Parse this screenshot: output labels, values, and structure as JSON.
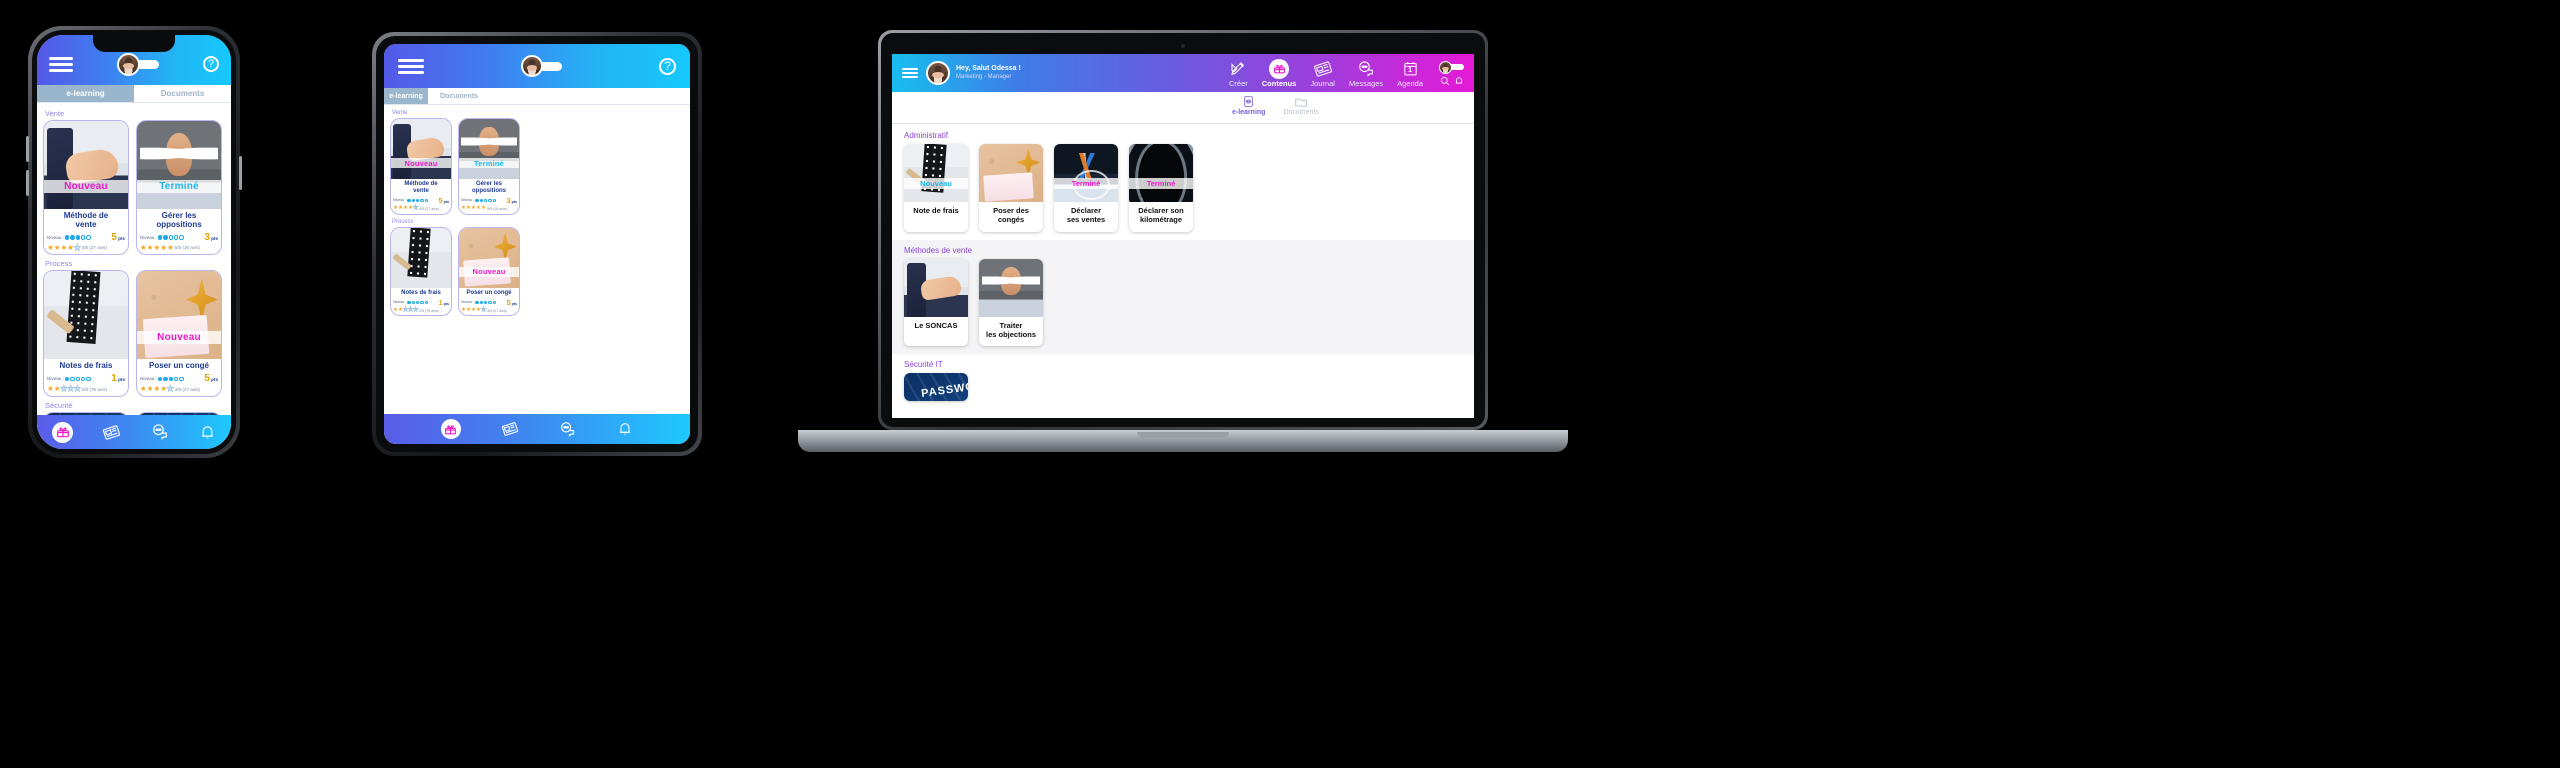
{
  "app": {
    "brand_gradient_start": "#5558e8",
    "brand_gradient_end": "#16c8ff",
    "accent_magenta": "#ee18c8",
    "accent_cyan": "#19b6ef",
    "title_blue": "#1f3a93"
  },
  "mobile": {
    "topbar": {
      "menu_icon": "hamburger-icon",
      "avatar_icon": "user-avatar",
      "help_label": "?"
    },
    "tabs": [
      {
        "label": "e-learning",
        "active": true
      },
      {
        "label": "Documents",
        "active": false
      }
    ],
    "sections": [
      {
        "title": "Vente",
        "cards": [
          {
            "badge": "Nouveau",
            "badge_type": "nouveau",
            "thumb": "t-handshake",
            "title": "Méthode de\nvente",
            "level_label": "Niveau :",
            "level_filled": 3,
            "level_total": 5,
            "points": "5",
            "points_unit": "pts",
            "stars_filled": 4,
            "stars_total": 5,
            "rating": "4/5 (27 avis)"
          },
          {
            "badge": "Terminé",
            "badge_type": "termine",
            "thumb": "t-angry",
            "title": "Gérer les\noppositions",
            "level_label": "Niveau :",
            "level_filled": 2,
            "level_total": 5,
            "points": "3",
            "points_unit": "pts",
            "stars_filled": 5,
            "stars_total": 5,
            "rating": "5/5 (16 avis)"
          }
        ]
      },
      {
        "title": "Process",
        "cards": [
          {
            "badge": "",
            "badge_type": "none",
            "thumb": "t-notes",
            "title": "Notes de frais",
            "level_label": "Niveau :",
            "level_filled": 1,
            "level_total": 5,
            "points": "1",
            "points_unit": "pts",
            "stars_filled": 2,
            "stars_total": 5,
            "rating": "2/5 (75 avis)"
          },
          {
            "badge": "Nouveau",
            "badge_type": "nouveau",
            "thumb": "t-cork",
            "title": "Poser un congé",
            "level_label": "Niveau :",
            "level_filled": 3,
            "level_total": 5,
            "points": "5",
            "points_unit": "pts",
            "stars_filled": 4,
            "stars_total": 5,
            "rating": "4/5 (27 avis)"
          }
        ]
      },
      {
        "title": "Sécurité",
        "cards": [
          {
            "badge": "",
            "badge_type": "none",
            "thumb": "t-security",
            "title": "",
            "level_label": "",
            "level_filled": 0,
            "level_total": 5,
            "points": "",
            "points_unit": "",
            "stars_filled": 0,
            "stars_total": 5,
            "rating": ""
          },
          {
            "badge": "",
            "badge_type": "none",
            "thumb": "t-password",
            "title": "",
            "level_label": "",
            "level_filled": 0,
            "level_total": 5,
            "points": "",
            "points_unit": "",
            "stars_filled": 0,
            "stars_total": 5,
            "rating": ""
          }
        ]
      }
    ],
    "bottomnav": [
      {
        "icon": "contenus-gift-icon",
        "active": true
      },
      {
        "icon": "journal-news-icon",
        "active": false
      },
      {
        "icon": "messages-chat-icon",
        "active": false
      },
      {
        "icon": "notifications-bell-icon",
        "active": false
      }
    ]
  },
  "tablet": {
    "topbar": {
      "menu_icon": "hamburger-icon",
      "avatar_icon": "user-avatar",
      "help_label": "?"
    },
    "tabs": [
      {
        "label": "e-learning",
        "active": true
      },
      {
        "label": "Documents",
        "active": false
      }
    ],
    "sections": [
      {
        "title": "Vente",
        "cards": [
          {
            "badge": "Nouveau",
            "badge_type": "nouveau",
            "thumb": "t-handshake",
            "title": "Méthode de\nvente",
            "level_label": "Niveau :",
            "level_filled": 3,
            "level_total": 5,
            "points": "5",
            "points_unit": "pts",
            "stars_filled": 4,
            "stars_total": 5,
            "rating": "4/5 (27 avis)"
          },
          {
            "badge": "Terminé",
            "badge_type": "termine",
            "thumb": "t-angry",
            "title": "Gérer les\noppositions",
            "level_label": "Niveau :",
            "level_filled": 2,
            "level_total": 5,
            "points": "3",
            "points_unit": "pts",
            "stars_filled": 5,
            "stars_total": 5,
            "rating": "5/5 (16 avis)"
          }
        ]
      },
      {
        "title": "Process",
        "cards": [
          {
            "badge": "",
            "badge_type": "none",
            "thumb": "t-notes",
            "title": "Notes de frais",
            "level_label": "Niveau :",
            "level_filled": 1,
            "level_total": 5,
            "points": "1",
            "points_unit": "pts",
            "stars_filled": 2,
            "stars_total": 5,
            "rating": "2/5 (75 avis)"
          },
          {
            "badge": "Nouveau",
            "badge_type": "nouveau",
            "thumb": "t-cork",
            "title": "Poser un congé",
            "level_label": "Niveau :",
            "level_filled": 3,
            "level_total": 5,
            "points": "5",
            "points_unit": "pts",
            "stars_filled": 4,
            "stars_total": 5,
            "rating": "4/5 (27 avis)"
          }
        ]
      }
    ],
    "bottomnav": [
      {
        "icon": "contenus-gift-icon",
        "active": true
      },
      {
        "icon": "journal-news-icon",
        "active": false
      },
      {
        "icon": "messages-chat-icon",
        "active": false
      },
      {
        "icon": "notifications-bell-icon",
        "active": false
      }
    ]
  },
  "laptop": {
    "topbar": {
      "menu_icon": "hamburger-icon",
      "avatar_icon": "user-avatar",
      "greeting": "Hey, Salut Odessa !",
      "role": "Marketing - Manager",
      "search_icon": "search-icon",
      "notification_icon": "bell-icon"
    },
    "nav": [
      {
        "label": "Créer",
        "icon": "pencil-ruler-icon",
        "active": false
      },
      {
        "label": "Contenus",
        "icon": "gift-box-icon",
        "active": true
      },
      {
        "label": "Journal",
        "icon": "newspaper-icon",
        "active": false
      },
      {
        "label": "Messages",
        "icon": "chat-bubble-icon",
        "active": false
      },
      {
        "label": "Agenda",
        "icon": "calendar-icon",
        "calendar_day": "1",
        "active": false
      }
    ],
    "subtabs": [
      {
        "label": "e-learning",
        "icon": "graduation-tablet-icon",
        "active": true
      },
      {
        "label": "Documents",
        "icon": "folder-icon",
        "active": false
      }
    ],
    "sections": [
      {
        "title": "Administratif",
        "alt": false,
        "cards": [
          {
            "badge": "Nouveau",
            "badge_type": "termine",
            "thumb": "t-notes",
            "title": "Note de frais"
          },
          {
            "badge": "",
            "badge_type": "none",
            "thumb": "t-cork",
            "title": "Poser des congés"
          },
          {
            "badge": "Terminé",
            "badge_type": "nouveau",
            "thumb": "t-chart",
            "title": "Déclarer\nses ventes"
          },
          {
            "badge": "Terminé",
            "badge_type": "nouveau",
            "thumb": "t-speedo",
            "title": "Déclarer son\nkilométrage"
          }
        ]
      },
      {
        "title": "Méthodes de vente",
        "alt": true,
        "cards": [
          {
            "badge": "",
            "badge_type": "none",
            "thumb": "t-handshake",
            "title": "Le SONCAS"
          },
          {
            "badge": "",
            "badge_type": "none",
            "thumb": "t-angry",
            "title": "Traiter\nles objections"
          }
        ]
      },
      {
        "title": "Sécurité IT",
        "alt": false,
        "cards": [
          {
            "badge": "",
            "badge_type": "none",
            "thumb": "t-password",
            "title": ""
          }
        ]
      }
    ]
  }
}
